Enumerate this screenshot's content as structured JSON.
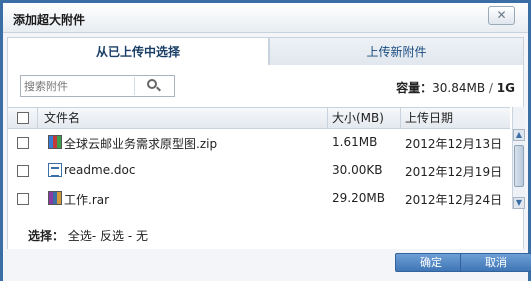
{
  "window": {
    "title": "添加超大附件"
  },
  "tabs": [
    {
      "label": "从已上传中选择",
      "active": true
    },
    {
      "label": "上传新附件",
      "active": false
    }
  ],
  "search": {
    "placeholder": "搜索附件",
    "value": ""
  },
  "capacity": {
    "label": "容量：",
    "used": "30.84MB",
    "separator": "/",
    "total": "1G"
  },
  "table": {
    "columns": [
      "文件名",
      "大小(MB)",
      "上传日期"
    ],
    "rows": [
      {
        "name": "全球云邮业务需求原型图.zip",
        "size": "1.61MB",
        "date": "2012年12月13日",
        "icon": "zip-icon"
      },
      {
        "name": "readme.doc",
        "size": "30.00KB",
        "date": "2012年12月19日",
        "icon": "doc-icon"
      },
      {
        "name": "工作.rar",
        "size": "29.20MB",
        "date": "2012年12月24日",
        "icon": "rar-icon"
      }
    ]
  },
  "selection": {
    "label": "选择：",
    "all": "全选",
    "invert": "反选",
    "none": "无",
    "dash": "-"
  },
  "buttons": {
    "ok": "确定",
    "cancel": "取消"
  },
  "icons": {
    "close": "close-icon",
    "search": "search-icon"
  },
  "colors": {
    "frame": "#3a6ea5",
    "button": "#4a82c0",
    "tab_text": "#1a4c80"
  }
}
